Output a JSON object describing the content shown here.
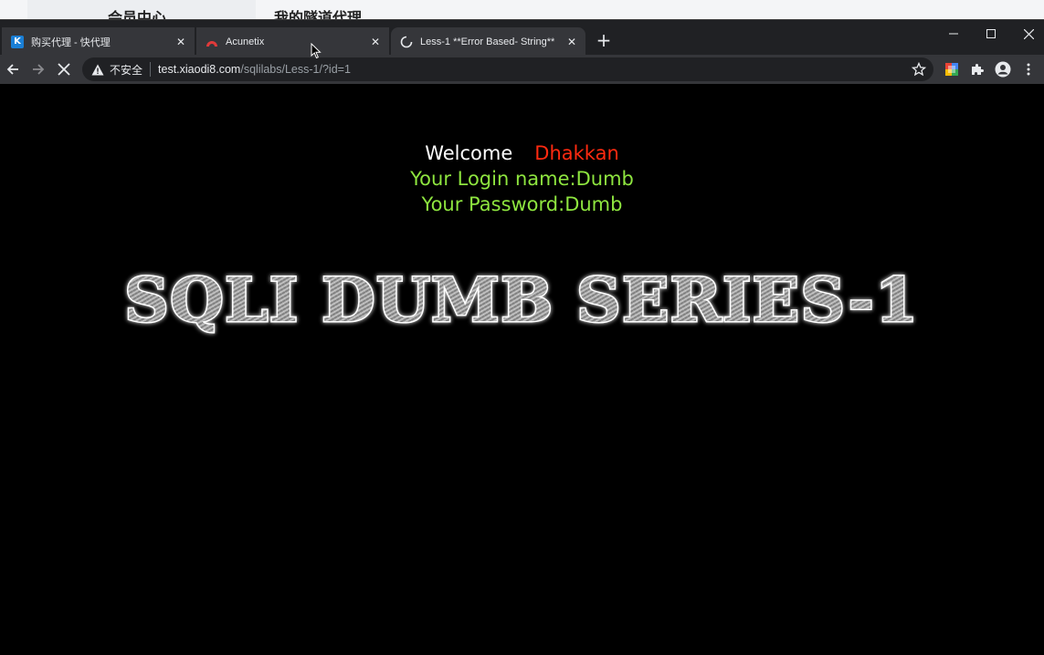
{
  "background_page": {
    "sidebar_text": "会员中心",
    "title": "我的隧道代理"
  },
  "tabs": [
    {
      "title": "购买代理 - 快代理",
      "favicon": "kuaidaili-icon",
      "active": false
    },
    {
      "title": "Acunetix",
      "favicon": "acunetix-icon",
      "active": false
    },
    {
      "title": "Less-1 **Error Based- String**",
      "favicon": "loading-spinner-icon",
      "active": true
    }
  ],
  "address_bar": {
    "security_label": "不安全",
    "url_host": "test.xiaodi8.com",
    "url_path": "/sqlilabs/Less-1/?id=1"
  },
  "page": {
    "welcome": "Welcome",
    "name": "Dhakkan",
    "login_line": "Your Login name:Dumb",
    "password_line": "Your Password:Dumb",
    "banner_text": "SQLI DUMB SERIES-1"
  },
  "colors": {
    "welcome": "#ffffff",
    "name": "#ff2a10",
    "info": "#8ee53f",
    "background": "#000000"
  }
}
